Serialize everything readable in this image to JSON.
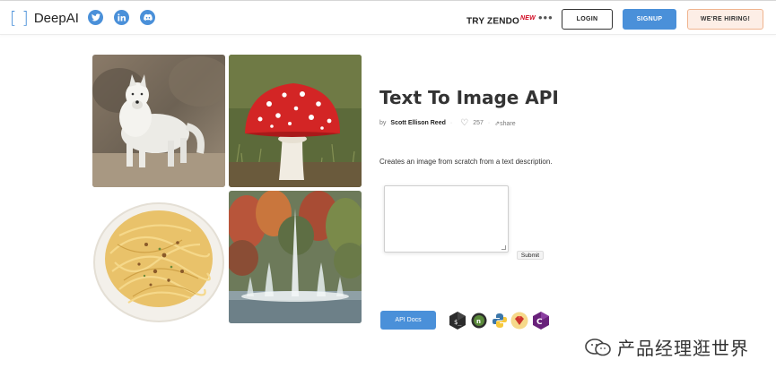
{
  "header": {
    "logo_bracket_open": "[",
    "logo_bracket_close": "]",
    "logo_name": "DeepAI",
    "social": [
      {
        "icon": "twitter-icon",
        "glyph": "t"
      },
      {
        "icon": "linkedin-icon",
        "glyph": "in"
      },
      {
        "icon": "discord-icon",
        "glyph": "d"
      }
    ],
    "try_label": "TRY ZENDO",
    "try_badge": "NEW",
    "more_label": "•••",
    "login_label": "LOGIN",
    "signup_label": "SIGNUP",
    "hiring_label": "WE'RE HIRING!",
    "accent_color": "#4a90d9"
  },
  "gallery": {
    "images": [
      {
        "subject": "white wolf"
      },
      {
        "subject": "red mushroom"
      },
      {
        "subject": "pasta"
      },
      {
        "subject": "fountain"
      }
    ]
  },
  "main": {
    "title": "Text To Image API",
    "by_label": "by",
    "author": "Scott Ellison Reed",
    "likes": "257",
    "share_label": "share",
    "description": "Creates an image from scratch from a text description.",
    "textarea_value": "",
    "submit_label": "Submit",
    "api_docs_label": "API Docs",
    "language_icons": [
      "bash-icon",
      "nodejs-icon",
      "python-icon",
      "ruby-icon",
      "csharp-icon"
    ]
  },
  "watermark": {
    "text": "产品经理逛世界"
  }
}
